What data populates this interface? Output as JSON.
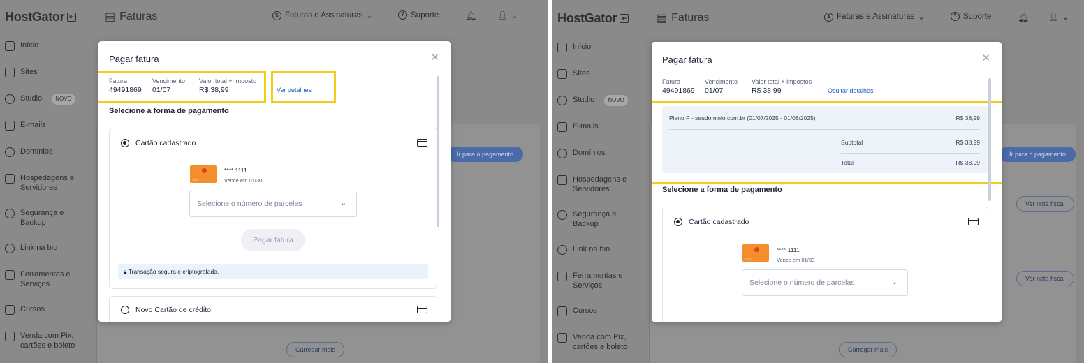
{
  "app": {
    "logo": "HostGator",
    "page_title": "Faturas",
    "nav_faturas": "Faturas e Assinaturas",
    "nav_suporte": "Suporte"
  },
  "sidebar": {
    "items": [
      {
        "label": "Início"
      },
      {
        "label": "Sites"
      },
      {
        "label": "Studio",
        "badge": "NOVO"
      },
      {
        "label": "E-mails"
      },
      {
        "label": "Domínios"
      },
      {
        "label": "Hospedagens e Servidores"
      },
      {
        "label": "Segurança e Backup"
      },
      {
        "label": "Link na bio"
      },
      {
        "label": "Ferramentas e Serviços"
      },
      {
        "label": "Cursos"
      },
      {
        "label": "Venda com Pix, cartões e boleto"
      }
    ]
  },
  "background": {
    "go_to_payment": "Ir para o pagamento",
    "see_invoice": "Ver nota fiscal",
    "load_more": "Carregar mais"
  },
  "modal": {
    "title": "Pagar fatura",
    "invoice_label": "Fatura",
    "invoice_value": "49491869",
    "due_label": "Vencimento",
    "due_value": "01/07",
    "total_label_left": "Valor total + Imposto",
    "total_label_right": "Valor total + impostos",
    "total_value": "R$ 38,99",
    "show_details": "Ver detalhes",
    "hide_details": "Ocultar detalhes",
    "select_payment": "Selecione a forma de pagamento",
    "saved_card": "Cartão cadastrado",
    "card_number": "**** 1111",
    "card_expiry": "Vence em 01/30",
    "installments_placeholder": "Selecione o número de parcelas",
    "pay_button": "Pagar fatura",
    "secure_note": "Transação segura e criptografada.",
    "new_card": "Novo Cartão de crédito"
  },
  "details": {
    "item": "Plano P - seudominio.com.br (01/07/2025 - 01/08/2025)",
    "item_value": "R$ 38,99",
    "subtotal_label": "Subtotal",
    "subtotal_value": "R$ 38,99",
    "total_label": "Total",
    "total_value": "R$ 38,99"
  },
  "colors": {
    "highlight": "#f2cd1a",
    "link": "#1f5fbf",
    "overlay": "#8a8a8a"
  }
}
